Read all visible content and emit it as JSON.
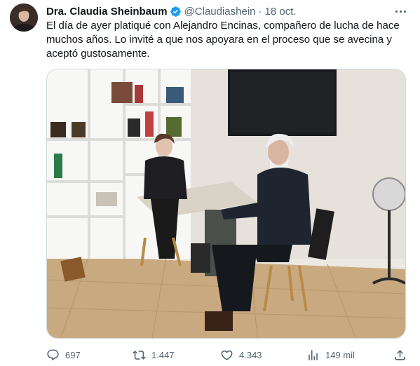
{
  "tweet": {
    "author_name": "Dra. Claudia Sheinbaum",
    "handle": "@Claudiashein",
    "separator": "·",
    "date": "18 oct.",
    "text": "El día de ayer platiqué con Alejandro Encinas, compañero de lucha de hace muchos años. Lo invité a que nos apoyara en el proceso que se avecina y aceptó gustosamente."
  },
  "icons": {
    "verified": "verified-badge-icon",
    "more": "more-options-icon",
    "reply": "reply-icon",
    "retweet": "retweet-icon",
    "like": "heart-icon",
    "views": "views-chart-icon",
    "share": "share-icon"
  },
  "metrics": {
    "replies": "697",
    "retweets": "1.447",
    "likes": "4.343",
    "views": "149 mil"
  },
  "colors": {
    "text_primary": "#0f1419",
    "text_secondary": "#536471",
    "verified_blue": "#1d9bf0",
    "border": "#cfd9de"
  }
}
